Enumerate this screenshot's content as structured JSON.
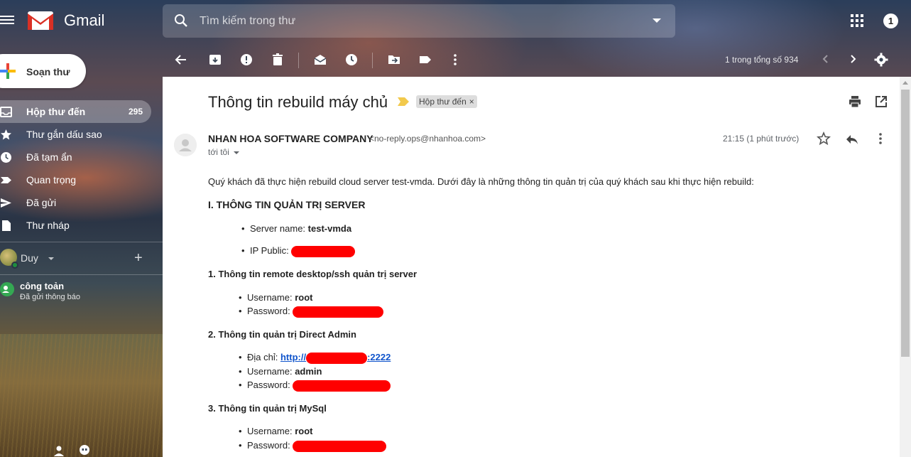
{
  "app": {
    "name": "Gmail",
    "notification_count": "1"
  },
  "search": {
    "placeholder": "Tìm kiếm trong thư"
  },
  "compose": {
    "label": "Soạn thư"
  },
  "sidebar": {
    "items": [
      {
        "label": "Hộp thư đến",
        "count": "295",
        "icon": "inbox-icon",
        "active": true
      },
      {
        "label": "Thư gắn dấu sao",
        "count": "",
        "icon": "star-icon"
      },
      {
        "label": "Đã tạm ẩn",
        "count": "",
        "icon": "clock-icon"
      },
      {
        "label": "Quan trọng",
        "count": "",
        "icon": "important-icon"
      },
      {
        "label": "Đã gửi",
        "count": "",
        "icon": "send-icon"
      },
      {
        "label": "Thư nháp",
        "count": "",
        "icon": "draft-icon"
      }
    ],
    "chat_user": "Duy",
    "hangout": {
      "name": "công toản",
      "status": "Đã gửi thông báo"
    }
  },
  "toolbar": {
    "pager": "1 trong tổng số 934"
  },
  "email": {
    "subject": "Thông tin rebuild máy chủ",
    "label": "Hộp thư đến",
    "label_close": "×",
    "sender_name": "NHAN HOA SOFTWARE COMPANY",
    "sender_email": "<no-reply.ops@nhanhoa.com>",
    "to": "tới tôi",
    "time": "21:15 (1 phút trước)",
    "intro": "Quý khách đã thực hiện rebuild cloud server test-vmda. Dưới đây là những thông tin quản trị của quý khách sau khi thực hiện rebuild:",
    "section1": {
      "title": "I. THÔNG TIN QUẢN TRỊ SERVER",
      "server_name_label": "Server name:",
      "server_name": "test-vmda",
      "ip_label": "IP Public:"
    },
    "section2": {
      "title": "1. Thông tin remote desktop/ssh quản trị server",
      "username_label": "Username:",
      "username": "root",
      "password_label": "Password:"
    },
    "section3": {
      "title": "2. Thông tin quản trị Direct Admin",
      "address_label": "Địa chỉ:",
      "address_prefix": "http://",
      "address_suffix": ":2222",
      "username_label": "Username:",
      "username": "admin",
      "password_label": "Password:"
    },
    "section4": {
      "title": "3. Thông tin quản trị MySql",
      "username_label": "Username:",
      "username": "root",
      "password_label": "Password:"
    }
  },
  "colors": {
    "accent_link": "#1155cc",
    "redaction": "#ff0000",
    "importance": "#f2c94c"
  }
}
